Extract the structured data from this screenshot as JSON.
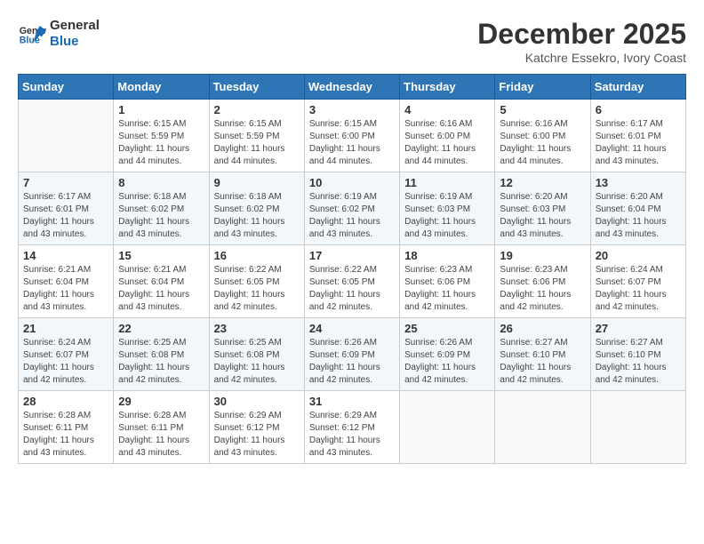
{
  "logo": {
    "line1": "General",
    "line2": "Blue"
  },
  "title": "December 2025",
  "location": "Katchre Essekro, Ivory Coast",
  "headers": [
    "Sunday",
    "Monday",
    "Tuesday",
    "Wednesday",
    "Thursday",
    "Friday",
    "Saturday"
  ],
  "weeks": [
    [
      {
        "day": "",
        "sunrise": "",
        "sunset": "",
        "daylight": ""
      },
      {
        "day": "1",
        "sunrise": "Sunrise: 6:15 AM",
        "sunset": "Sunset: 5:59 PM",
        "daylight": "Daylight: 11 hours and 44 minutes."
      },
      {
        "day": "2",
        "sunrise": "Sunrise: 6:15 AM",
        "sunset": "Sunset: 5:59 PM",
        "daylight": "Daylight: 11 hours and 44 minutes."
      },
      {
        "day": "3",
        "sunrise": "Sunrise: 6:15 AM",
        "sunset": "Sunset: 6:00 PM",
        "daylight": "Daylight: 11 hours and 44 minutes."
      },
      {
        "day": "4",
        "sunrise": "Sunrise: 6:16 AM",
        "sunset": "Sunset: 6:00 PM",
        "daylight": "Daylight: 11 hours and 44 minutes."
      },
      {
        "day": "5",
        "sunrise": "Sunrise: 6:16 AM",
        "sunset": "Sunset: 6:00 PM",
        "daylight": "Daylight: 11 hours and 44 minutes."
      },
      {
        "day": "6",
        "sunrise": "Sunrise: 6:17 AM",
        "sunset": "Sunset: 6:01 PM",
        "daylight": "Daylight: 11 hours and 43 minutes."
      }
    ],
    [
      {
        "day": "7",
        "sunrise": "Sunrise: 6:17 AM",
        "sunset": "Sunset: 6:01 PM",
        "daylight": "Daylight: 11 hours and 43 minutes."
      },
      {
        "day": "8",
        "sunrise": "Sunrise: 6:18 AM",
        "sunset": "Sunset: 6:02 PM",
        "daylight": "Daylight: 11 hours and 43 minutes."
      },
      {
        "day": "9",
        "sunrise": "Sunrise: 6:18 AM",
        "sunset": "Sunset: 6:02 PM",
        "daylight": "Daylight: 11 hours and 43 minutes."
      },
      {
        "day": "10",
        "sunrise": "Sunrise: 6:19 AM",
        "sunset": "Sunset: 6:02 PM",
        "daylight": "Daylight: 11 hours and 43 minutes."
      },
      {
        "day": "11",
        "sunrise": "Sunrise: 6:19 AM",
        "sunset": "Sunset: 6:03 PM",
        "daylight": "Daylight: 11 hours and 43 minutes."
      },
      {
        "day": "12",
        "sunrise": "Sunrise: 6:20 AM",
        "sunset": "Sunset: 6:03 PM",
        "daylight": "Daylight: 11 hours and 43 minutes."
      },
      {
        "day": "13",
        "sunrise": "Sunrise: 6:20 AM",
        "sunset": "Sunset: 6:04 PM",
        "daylight": "Daylight: 11 hours and 43 minutes."
      }
    ],
    [
      {
        "day": "14",
        "sunrise": "Sunrise: 6:21 AM",
        "sunset": "Sunset: 6:04 PM",
        "daylight": "Daylight: 11 hours and 43 minutes."
      },
      {
        "day": "15",
        "sunrise": "Sunrise: 6:21 AM",
        "sunset": "Sunset: 6:04 PM",
        "daylight": "Daylight: 11 hours and 43 minutes."
      },
      {
        "day": "16",
        "sunrise": "Sunrise: 6:22 AM",
        "sunset": "Sunset: 6:05 PM",
        "daylight": "Daylight: 11 hours and 42 minutes."
      },
      {
        "day": "17",
        "sunrise": "Sunrise: 6:22 AM",
        "sunset": "Sunset: 6:05 PM",
        "daylight": "Daylight: 11 hours and 42 minutes."
      },
      {
        "day": "18",
        "sunrise": "Sunrise: 6:23 AM",
        "sunset": "Sunset: 6:06 PM",
        "daylight": "Daylight: 11 hours and 42 minutes."
      },
      {
        "day": "19",
        "sunrise": "Sunrise: 6:23 AM",
        "sunset": "Sunset: 6:06 PM",
        "daylight": "Daylight: 11 hours and 42 minutes."
      },
      {
        "day": "20",
        "sunrise": "Sunrise: 6:24 AM",
        "sunset": "Sunset: 6:07 PM",
        "daylight": "Daylight: 11 hours and 42 minutes."
      }
    ],
    [
      {
        "day": "21",
        "sunrise": "Sunrise: 6:24 AM",
        "sunset": "Sunset: 6:07 PM",
        "daylight": "Daylight: 11 hours and 42 minutes."
      },
      {
        "day": "22",
        "sunrise": "Sunrise: 6:25 AM",
        "sunset": "Sunset: 6:08 PM",
        "daylight": "Daylight: 11 hours and 42 minutes."
      },
      {
        "day": "23",
        "sunrise": "Sunrise: 6:25 AM",
        "sunset": "Sunset: 6:08 PM",
        "daylight": "Daylight: 11 hours and 42 minutes."
      },
      {
        "day": "24",
        "sunrise": "Sunrise: 6:26 AM",
        "sunset": "Sunset: 6:09 PM",
        "daylight": "Daylight: 11 hours and 42 minutes."
      },
      {
        "day": "25",
        "sunrise": "Sunrise: 6:26 AM",
        "sunset": "Sunset: 6:09 PM",
        "daylight": "Daylight: 11 hours and 42 minutes."
      },
      {
        "day": "26",
        "sunrise": "Sunrise: 6:27 AM",
        "sunset": "Sunset: 6:10 PM",
        "daylight": "Daylight: 11 hours and 42 minutes."
      },
      {
        "day": "27",
        "sunrise": "Sunrise: 6:27 AM",
        "sunset": "Sunset: 6:10 PM",
        "daylight": "Daylight: 11 hours and 42 minutes."
      }
    ],
    [
      {
        "day": "28",
        "sunrise": "Sunrise: 6:28 AM",
        "sunset": "Sunset: 6:11 PM",
        "daylight": "Daylight: 11 hours and 43 minutes."
      },
      {
        "day": "29",
        "sunrise": "Sunrise: 6:28 AM",
        "sunset": "Sunset: 6:11 PM",
        "daylight": "Daylight: 11 hours and 43 minutes."
      },
      {
        "day": "30",
        "sunrise": "Sunrise: 6:29 AM",
        "sunset": "Sunset: 6:12 PM",
        "daylight": "Daylight: 11 hours and 43 minutes."
      },
      {
        "day": "31",
        "sunrise": "Sunrise: 6:29 AM",
        "sunset": "Sunset: 6:12 PM",
        "daylight": "Daylight: 11 hours and 43 minutes."
      },
      {
        "day": "",
        "sunrise": "",
        "sunset": "",
        "daylight": ""
      },
      {
        "day": "",
        "sunrise": "",
        "sunset": "",
        "daylight": ""
      },
      {
        "day": "",
        "sunrise": "",
        "sunset": "",
        "daylight": ""
      }
    ]
  ]
}
